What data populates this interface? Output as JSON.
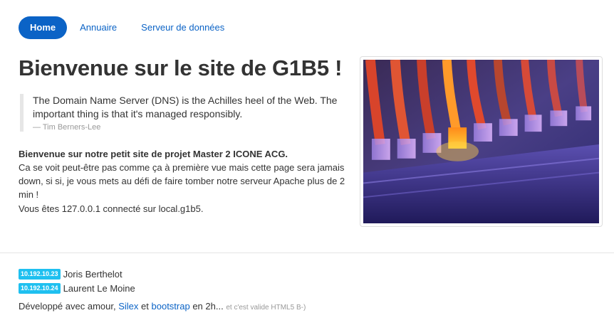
{
  "nav": {
    "items": [
      {
        "label": "Home"
      },
      {
        "label": "Annuaire"
      },
      {
        "label": "Serveur de données"
      }
    ]
  },
  "page_title": "Bienvenue sur le site de G1B5 !",
  "quote": {
    "text": "The Domain Name Server (DNS) is the Achilles heel of the Web. The important thing is that it's managed responsibly.",
    "source": "— Tim Berners-Lee"
  },
  "intro": {
    "lead": "Bienvenue sur notre petit site de projet Master 2 ICONE ACG.",
    "body": "Ca se voit peut-être pas comme ça à première vue mais cette page sera jamais down, si si, je vous mets au défi de faire tomber notre serveur Apache plus de 2 min !"
  },
  "status": "Vous êtes 127.0.0.1 connecté sur local.g1b5.",
  "members": [
    {
      "ip": "10.192.10.23",
      "name": "Joris Berthelot"
    },
    {
      "ip": "10.192.10.24",
      "name": "Laurent Le Moine"
    }
  ],
  "footer": {
    "prefix": "Développé avec amour,",
    "link1": "Silex",
    "and": "et",
    "link2": "bootstrap",
    "suffix": "en 2h...",
    "note": "et c'est valide HTML5 B-)"
  },
  "colors": {
    "accent": "#0b63c6",
    "badge": "#1fc0f0"
  }
}
